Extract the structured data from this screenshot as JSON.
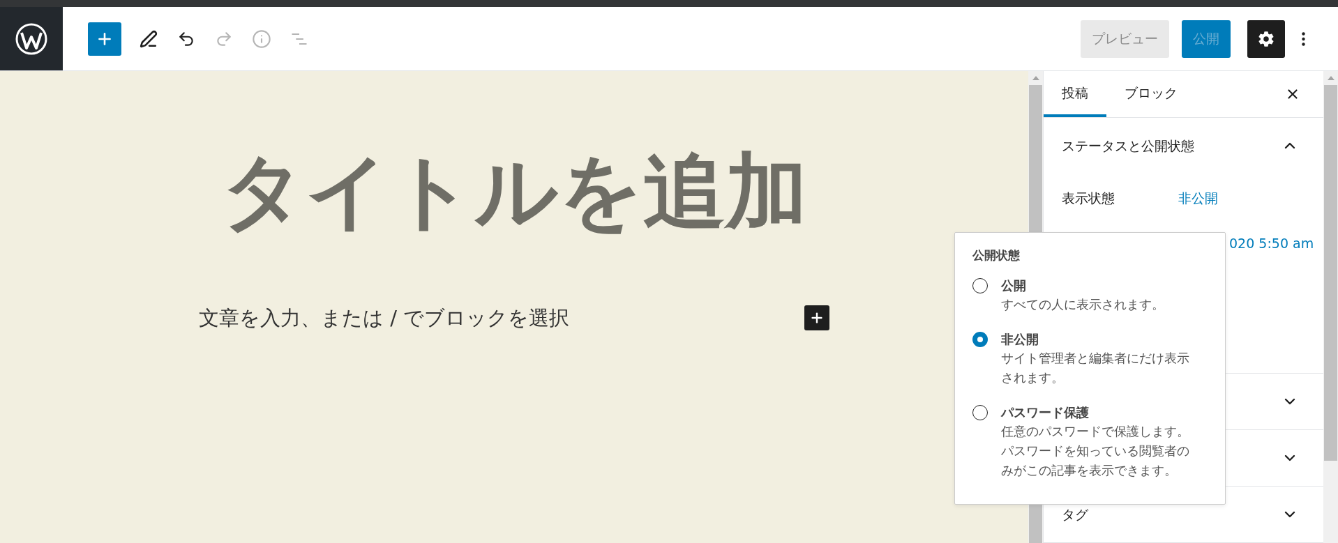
{
  "header": {
    "tools": [
      {
        "kind": "add",
        "disabled": false
      },
      {
        "kind": "edit",
        "disabled": false
      },
      {
        "kind": "undo",
        "disabled": false
      },
      {
        "kind": "redo",
        "disabled": true
      },
      {
        "kind": "info",
        "disabled": true
      },
      {
        "kind": "outline",
        "disabled": true
      }
    ],
    "preview": {
      "label": "プレビュー",
      "disabled": true
    },
    "publish": {
      "label": "公開",
      "disabled": true
    },
    "settings": {
      "selected": true
    }
  },
  "editor": {
    "title_placeholder": "タイトルを追加",
    "paragraph_placeholder": "文章を入力、または / でブロックを選択"
  },
  "sidebar": {
    "tabs": [
      {
        "label": "投稿",
        "selected": true
      },
      {
        "label": "ブロック",
        "selected": false
      }
    ],
    "panels": [
      {
        "title": "ステータスと公開状態",
        "expanded": true,
        "rows": [
          {
            "label": "表示状態",
            "value": "非公開"
          },
          {
            "value": "020 5:50 am"
          }
        ]
      },
      {
        "expanded": false
      },
      {
        "expanded": false
      },
      {
        "title": "タグ",
        "expanded": false
      }
    ]
  },
  "popover": {
    "title": "公開状態",
    "options": [
      {
        "label": "公開",
        "description": "すべての人に表示されます。",
        "selected": false
      },
      {
        "label": "非公開",
        "description": "サイト管理者と編集者にだけ表示されます。",
        "selected": true
      },
      {
        "label": "パスワード保護",
        "description": "任意のパスワードで保護します。パスワードを知っている閲覧者のみがこの記事を表示できます。",
        "selected": false
      }
    ]
  }
}
